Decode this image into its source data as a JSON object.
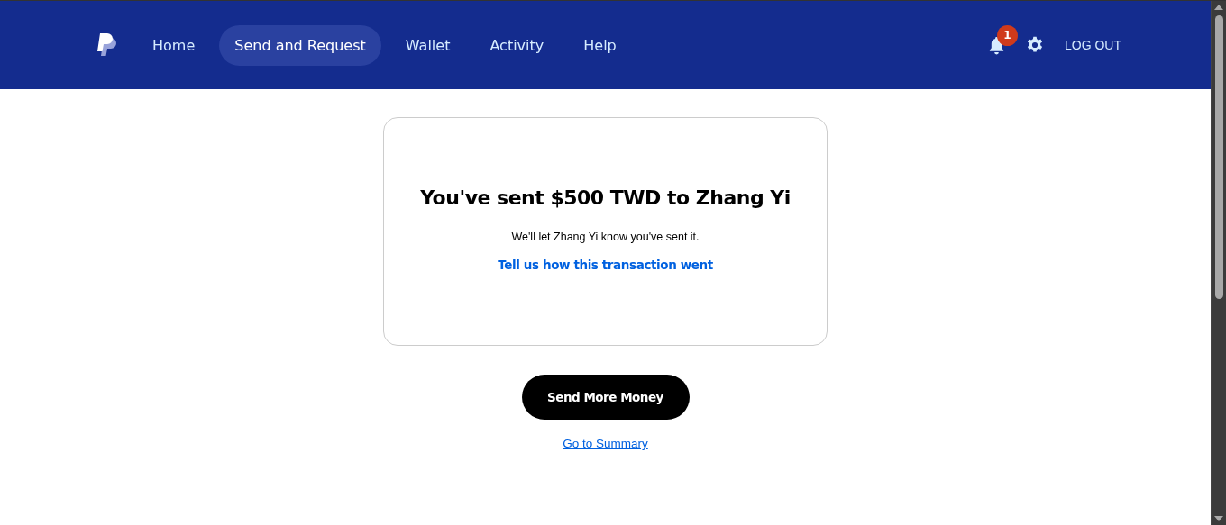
{
  "nav": {
    "items": [
      {
        "label": "Home",
        "selected": false
      },
      {
        "label": "Send and Request",
        "selected": true
      },
      {
        "label": "Wallet",
        "selected": false
      },
      {
        "label": "Activity",
        "selected": false
      },
      {
        "label": "Help",
        "selected": false
      }
    ],
    "notification_count": "1",
    "logout": "LOG OUT"
  },
  "confirmation": {
    "title": "You've sent $500 TWD to Zhang Yi",
    "message": "We'll let Zhang Yi know you've sent it.",
    "feedback_link": "Tell us how this transaction went"
  },
  "primary_button": "Send More Money",
  "summary_link": "Go to Summary"
}
